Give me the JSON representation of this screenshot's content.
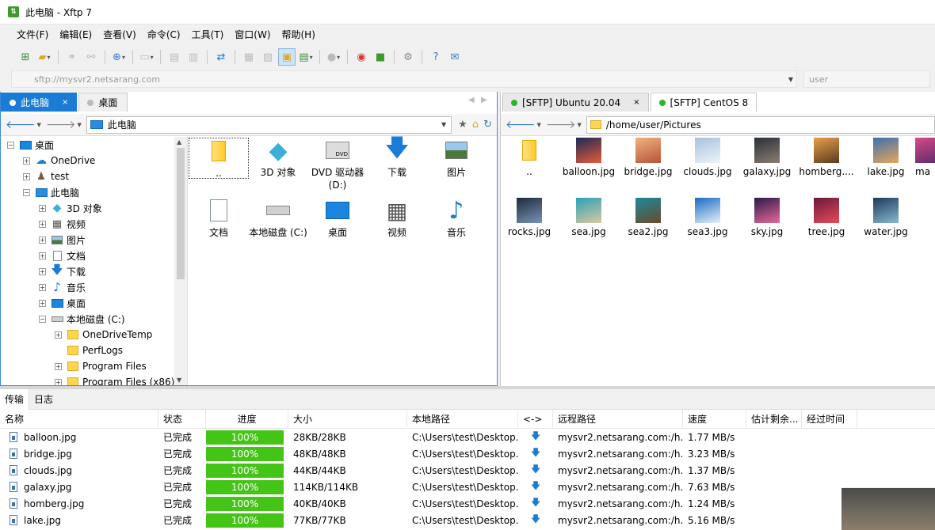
{
  "window": {
    "title": "此电脑 - Xftp 7"
  },
  "menu": [
    "文件(F)",
    "编辑(E)",
    "查看(V)",
    "命令(C)",
    "工具(T)",
    "窗口(W)",
    "帮助(H)"
  ],
  "address": {
    "value": "sftp://mysvr2.netsarang.com",
    "user_placeholder": "user"
  },
  "left": {
    "tabs": [
      {
        "label": "此电脑",
        "close": "×"
      },
      {
        "label": "桌面"
      }
    ],
    "path": "此电脑",
    "tree": [
      {
        "label": "桌面",
        "level": 0,
        "exp": "−",
        "icon": "desktop"
      },
      {
        "label": "OneDrive",
        "level": 1,
        "exp": "+",
        "icon": "cloud"
      },
      {
        "label": "test",
        "level": 1,
        "exp": "+",
        "icon": "user"
      },
      {
        "label": "此电脑",
        "level": 1,
        "exp": "−",
        "icon": "pc"
      },
      {
        "label": "3D 对象",
        "level": 2,
        "exp": "+",
        "icon": "cube"
      },
      {
        "label": "视频",
        "level": 2,
        "exp": "+",
        "icon": "film"
      },
      {
        "label": "图片",
        "level": 2,
        "exp": "+",
        "icon": "picture"
      },
      {
        "label": "文档",
        "level": 2,
        "exp": "+",
        "icon": "doc"
      },
      {
        "label": "下载",
        "level": 2,
        "exp": "+",
        "icon": "download"
      },
      {
        "label": "音乐",
        "level": 2,
        "exp": "+",
        "icon": "music"
      },
      {
        "label": "桌面",
        "level": 2,
        "exp": "+",
        "icon": "desktop"
      },
      {
        "label": "本地磁盘 (C:)",
        "level": 2,
        "exp": "−",
        "icon": "disk"
      },
      {
        "label": "OneDriveTemp",
        "level": 3,
        "exp": "+",
        "icon": "folder"
      },
      {
        "label": "PerfLogs",
        "level": 3,
        "exp": "",
        "icon": "folder"
      },
      {
        "label": "Program Files",
        "level": 3,
        "exp": "+",
        "icon": "folder"
      },
      {
        "label": "Program Files (x86)",
        "level": 3,
        "exp": "+",
        "icon": "folder"
      }
    ],
    "items": [
      {
        "label": "..",
        "icon": "folder"
      },
      {
        "label": "3D 对象",
        "icon": "cube"
      },
      {
        "label": "DVD 驱动器 (D:)",
        "icon": "dvd"
      },
      {
        "label": "下载",
        "icon": "download"
      },
      {
        "label": "图片",
        "icon": "picture"
      },
      {
        "label": "文档",
        "icon": "doc"
      },
      {
        "label": "本地磁盘 (C:)",
        "icon": "disk"
      },
      {
        "label": "桌面",
        "icon": "desktop"
      },
      {
        "label": "视频",
        "icon": "film"
      },
      {
        "label": "音乐",
        "icon": "music"
      }
    ]
  },
  "right": {
    "tabs": [
      {
        "label": "[SFTP] Ubuntu 20.04",
        "close": "×",
        "dot": "#2bb52b"
      },
      {
        "label": "[SFTP] CentOS 8",
        "dot": "#2bb52b"
      }
    ],
    "path": "/home/user/Pictures",
    "items": [
      {
        "label": "..",
        "icon": "folder"
      },
      {
        "label": "balloon.jpg",
        "colors": [
          "#1c2a55",
          "#e85a3a"
        ]
      },
      {
        "label": "bridge.jpg",
        "colors": [
          "#f3b37a",
          "#b5543a"
        ]
      },
      {
        "label": "clouds.jpg",
        "colors": [
          "#a7c2e0",
          "#eef3f8"
        ]
      },
      {
        "label": "galaxy.jpg",
        "colors": [
          "#2a2f3a",
          "#8a7e70"
        ]
      },
      {
        "label": "homberg....",
        "colors": [
          "#e8a04a",
          "#5b3a1e"
        ]
      },
      {
        "label": "lake.jpg",
        "colors": [
          "#3b6fb0",
          "#e9a65a"
        ]
      },
      {
        "label": "ma",
        "colors": [
          "#d94a8a",
          "#5b2a6a"
        ]
      },
      {
        "label": "rocks.jpg",
        "colors": [
          "#1d2a3c",
          "#7a95b8"
        ]
      },
      {
        "label": "sea.jpg",
        "colors": [
          "#2aa0b8",
          "#d9c9a0"
        ]
      },
      {
        "label": "sea2.jpg",
        "colors": [
          "#1c8a9c",
          "#6a4a2a"
        ]
      },
      {
        "label": "sea3.jpg",
        "colors": [
          "#1a6cc4",
          "#e6f0fa"
        ]
      },
      {
        "label": "sky.jpg",
        "colors": [
          "#2a1a4a",
          "#e86a9a"
        ]
      },
      {
        "label": "tree.jpg",
        "colors": [
          "#6a1a3a",
          "#e84a5a"
        ]
      },
      {
        "label": "water.jpg",
        "colors": [
          "#1c3a5a",
          "#8ab8d0"
        ]
      }
    ]
  },
  "transfer": {
    "tabs": [
      "传输",
      "日志"
    ],
    "columns": [
      "名称",
      "状态",
      "进度",
      "大小",
      "本地路径",
      "<->",
      "远程路径",
      "速度",
      "估计剩余...",
      "经过时间"
    ],
    "rows": [
      {
        "name": "balloon.jpg",
        "status": "已完成",
        "progress": "100%",
        "progress_value": 1.0,
        "size": "28KB/28KB",
        "local": "C:\\Users\\test\\Desktop.",
        "remote": "mysvr2.netsarang.com:/h...",
        "speed": "1.77 MB/s"
      },
      {
        "name": "bridge.jpg",
        "status": "已完成",
        "progress": "100%",
        "progress_value": 1.0,
        "size": "48KB/48KB",
        "local": "C:\\Users\\test\\Desktop.",
        "remote": "mysvr2.netsarang.com:/h...",
        "speed": "3.23 MB/s"
      },
      {
        "name": "clouds.jpg",
        "status": "已完成",
        "progress": "100%",
        "progress_value": 1.0,
        "size": "44KB/44KB",
        "local": "C:\\Users\\test\\Desktop.",
        "remote": "mysvr2.netsarang.com:/h...",
        "speed": "1.37 MB/s"
      },
      {
        "name": "galaxy.jpg",
        "status": "已完成",
        "progress": "100%",
        "progress_value": 1.0,
        "size": "114KB/114KB",
        "local": "C:\\Users\\test\\Desktop.",
        "remote": "mysvr2.netsarang.com:/h...",
        "speed": "7.63 MB/s"
      },
      {
        "name": "homberg.jpg",
        "status": "已完成",
        "progress": "100%",
        "progress_value": 1.0,
        "size": "40KB/40KB",
        "local": "C:\\Users\\test\\Desktop.",
        "remote": "mysvr2.netsarang.com:/h...",
        "speed": "1.24 MB/s"
      },
      {
        "name": "lake.jpg",
        "status": "已完成",
        "progress": "100%",
        "progress_value": 1.0,
        "size": "77KB/77KB",
        "local": "C:\\Users\\test\\Desktop.",
        "remote": "mysvr2.netsarang.com:/h...",
        "speed": "5.16 MB/s"
      }
    ]
  }
}
